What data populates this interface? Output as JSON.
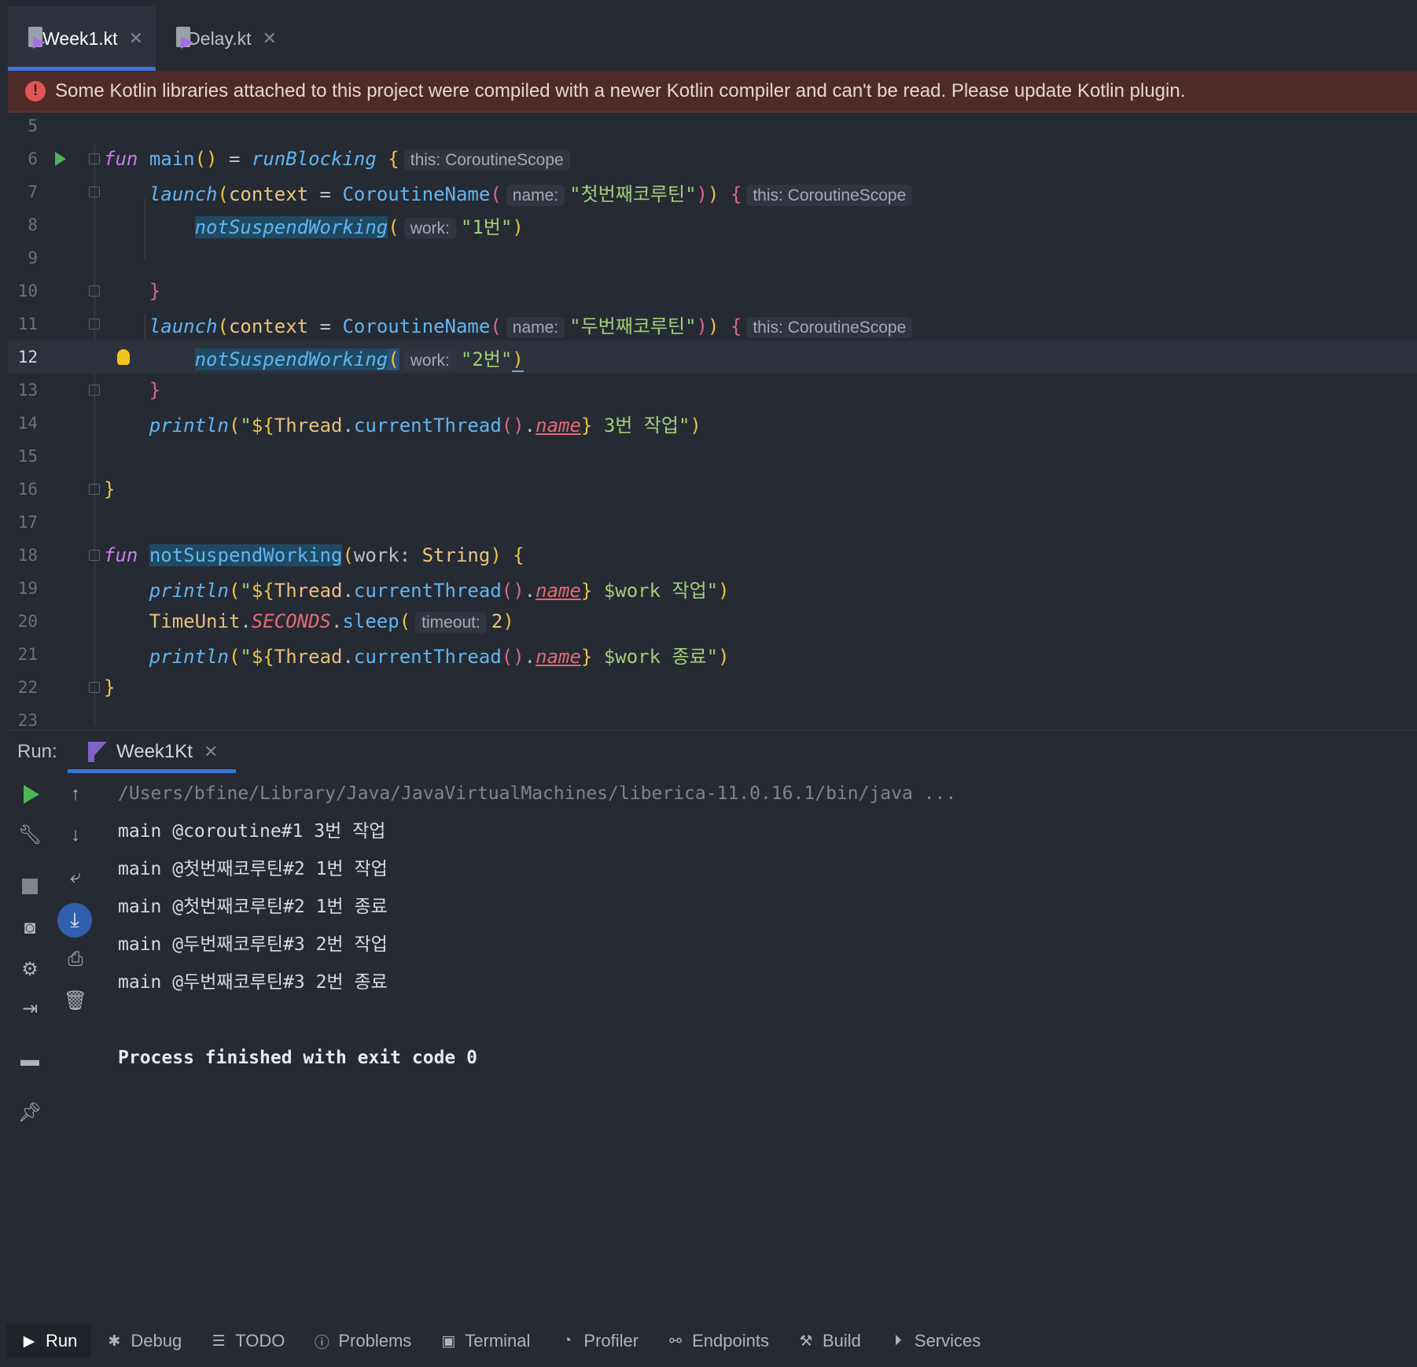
{
  "tabs": [
    {
      "label": "Week1.kt",
      "active": true
    },
    {
      "label": "Delay.kt",
      "active": false
    }
  ],
  "banner": {
    "text": "Some Kotlin libraries attached to this project were compiled with a newer Kotlin compiler and can't be read. Please update Kotlin plugin."
  },
  "editor": {
    "line_numbers": [
      "5",
      "6",
      "7",
      "8",
      "9",
      "10",
      "11",
      "12",
      "13",
      "14",
      "15",
      "16",
      "17",
      "18",
      "19",
      "20",
      "21",
      "22",
      "23"
    ],
    "current_line": "12",
    "hints": {
      "scope": "this: CoroutineScope",
      "name": "name:",
      "work": "work:",
      "timeout": "timeout:"
    },
    "strings": {
      "coroutine1": "\"첫번째코루틴\"",
      "coroutine2": "\"두번째코루틴\"",
      "work1": "\"1번\"",
      "work2": "\"2번\"",
      "job3": " 3번 작업\"",
      "work_start": " $work 작업\"",
      "work_end": " $work 종료\""
    }
  },
  "run_panel": {
    "label": "Run:",
    "tab_label": "Week1Kt",
    "console_lines": [
      "/Users/bfine/Library/Java/JavaVirtualMachines/liberica-11.0.16.1/bin/java ...",
      "main @coroutine#1 3번 작업",
      "main @첫번째코루틴#2 1번 작업",
      "main @첫번째코루틴#2 1번 종료",
      "main @두번째코루틴#3 2번 작업",
      "main @두번째코루틴#3 2번 종료",
      "",
      "Process finished with exit code 0"
    ]
  },
  "bottom_bar": [
    {
      "label": "Run",
      "icon": "play-icon",
      "active": true
    },
    {
      "label": "Debug",
      "icon": "bug-icon",
      "active": false
    },
    {
      "label": "TODO",
      "icon": "list-icon",
      "active": false
    },
    {
      "label": "Problems",
      "icon": "alert-icon",
      "active": false
    },
    {
      "label": "Terminal",
      "icon": "terminal-icon",
      "active": false
    },
    {
      "label": "Profiler",
      "icon": "profiler-icon",
      "active": false
    },
    {
      "label": "Endpoints",
      "icon": "endpoints-icon",
      "active": false
    },
    {
      "label": "Build",
      "icon": "hammer-icon",
      "active": false
    },
    {
      "label": "Services",
      "icon": "services-icon",
      "active": false
    }
  ],
  "colors": {
    "background": "#262a33",
    "accent": "#3d74db",
    "error_banner": "#4e2a28",
    "run_green": "#4db357"
  }
}
